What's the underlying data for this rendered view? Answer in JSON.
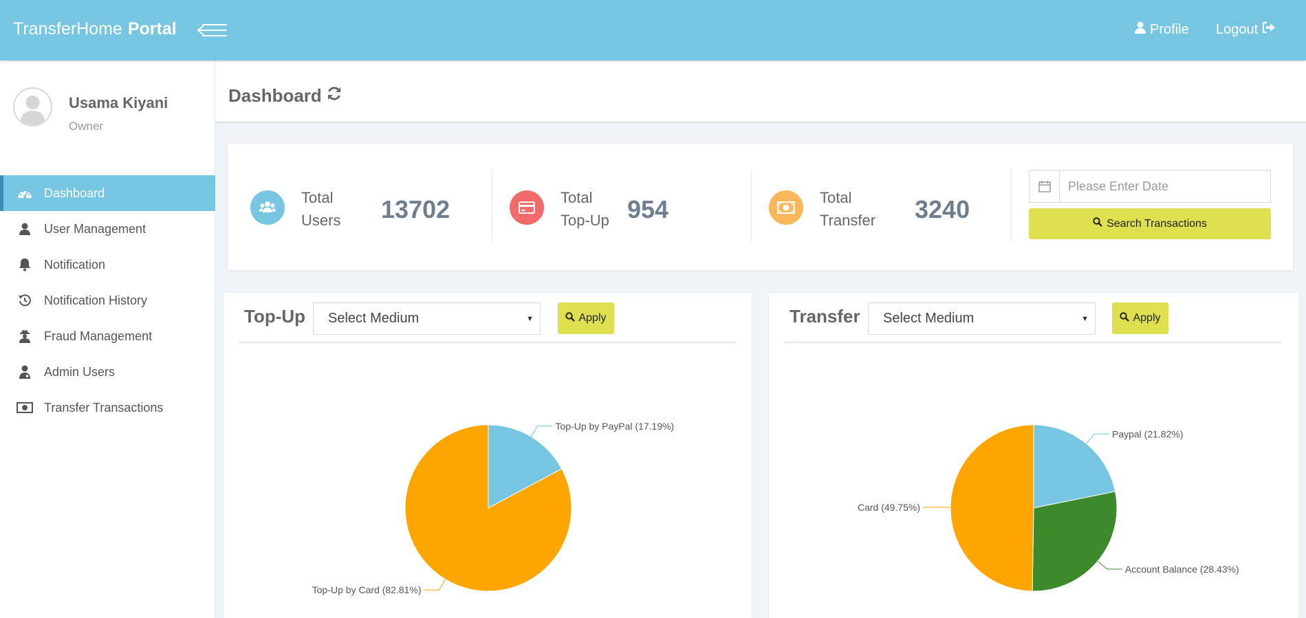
{
  "brand": {
    "name": "TransferHome",
    "portal": "Portal"
  },
  "topbar": {
    "profile_label": "Profile",
    "logout_label": "Logout"
  },
  "user": {
    "name": "Usama Kiyani",
    "role": "Owner"
  },
  "sidebar": {
    "items": [
      {
        "label": "Dashboard",
        "icon": "dashboard-icon",
        "active": true
      },
      {
        "label": "User Management",
        "icon": "user-icon"
      },
      {
        "label": "Notification",
        "icon": "bell-icon"
      },
      {
        "label": "Notification History",
        "icon": "history-icon"
      },
      {
        "label": "Fraud Management",
        "icon": "user-secret-icon"
      },
      {
        "label": "Admin Users",
        "icon": "user-md-icon"
      },
      {
        "label": "Transfer Transactions",
        "icon": "money-icon"
      }
    ]
  },
  "page": {
    "title": "Dashboard"
  },
  "stats": {
    "users": {
      "label_1": "Total",
      "label_2": "Users",
      "value": "13702",
      "color": "#76c6e1"
    },
    "topup": {
      "label_1": "Total",
      "label_2": "Top-Up",
      "value": "954",
      "color": "#f26b6b"
    },
    "transfer": {
      "label_1": "Total",
      "label_2": "Transfer",
      "value": "3240",
      "color": "#fbb759"
    }
  },
  "search": {
    "date_placeholder": "Please Enter Date",
    "button_label": "Search Transactions"
  },
  "colors": {
    "accent": "#76c6e1",
    "button": "#dfe050",
    "orange": "#ffa500",
    "green": "#3d8a2d"
  },
  "panels": {
    "topup": {
      "title": "Top-Up",
      "select_value": "Select Medium",
      "apply_label": "Apply"
    },
    "transfer": {
      "title": "Transfer",
      "select_value": "Select Medium",
      "apply_label": "Apply"
    }
  },
  "chart_data": [
    {
      "type": "pie",
      "title": "",
      "slices": [
        {
          "label": "Top-Up by PayPal (17.19%)",
          "value": 17.19,
          "color": "#76c6e1"
        },
        {
          "label": "Top-Up by Card (82.81%)",
          "value": 82.81,
          "color": "#ffa500"
        }
      ]
    },
    {
      "type": "pie",
      "title": "",
      "slices": [
        {
          "label": "Paypal (21.82%)",
          "value": 21.82,
          "color": "#76c6e1"
        },
        {
          "label": "Account Balance (28.43%)",
          "value": 28.43,
          "color": "#3d8a2d"
        },
        {
          "label": "Card (49.75%)",
          "value": 49.75,
          "color": "#ffa500"
        }
      ]
    }
  ]
}
